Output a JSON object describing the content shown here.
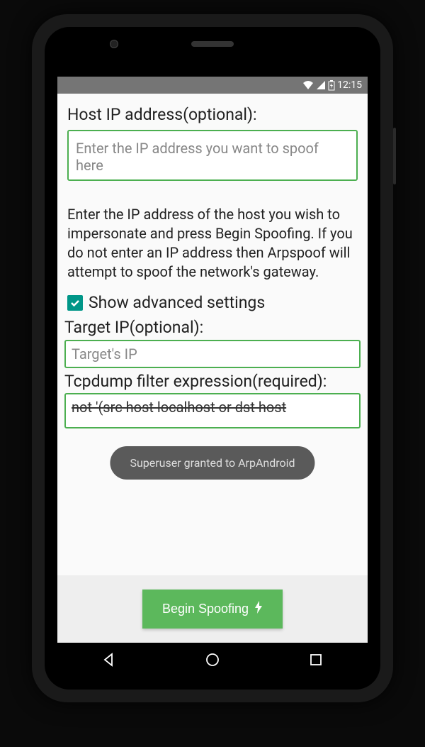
{
  "statusBar": {
    "time": "12:15"
  },
  "hostIp": {
    "label": "Host IP address(optional):",
    "placeholder": "Enter the IP address you want to spoof here",
    "value": ""
  },
  "helperText": "Enter the IP address of the host you wish to impersonate and press Begin Spoofing. If you do not enter an IP address then Arpspoof will attempt to spoof the network's gateway.",
  "advancedCheckbox": {
    "checked": true,
    "label": "Show advanced settings"
  },
  "targetIp": {
    "label": "Target IP(optional):",
    "placeholder": "Target's IP",
    "value": ""
  },
  "tcpdump": {
    "label": "Tcpdump filter expression(required):",
    "value": "not '(src host localhost or dst host"
  },
  "toast": "Superuser granted to ArpAndroid",
  "beginButton": "Begin Spoofing"
}
